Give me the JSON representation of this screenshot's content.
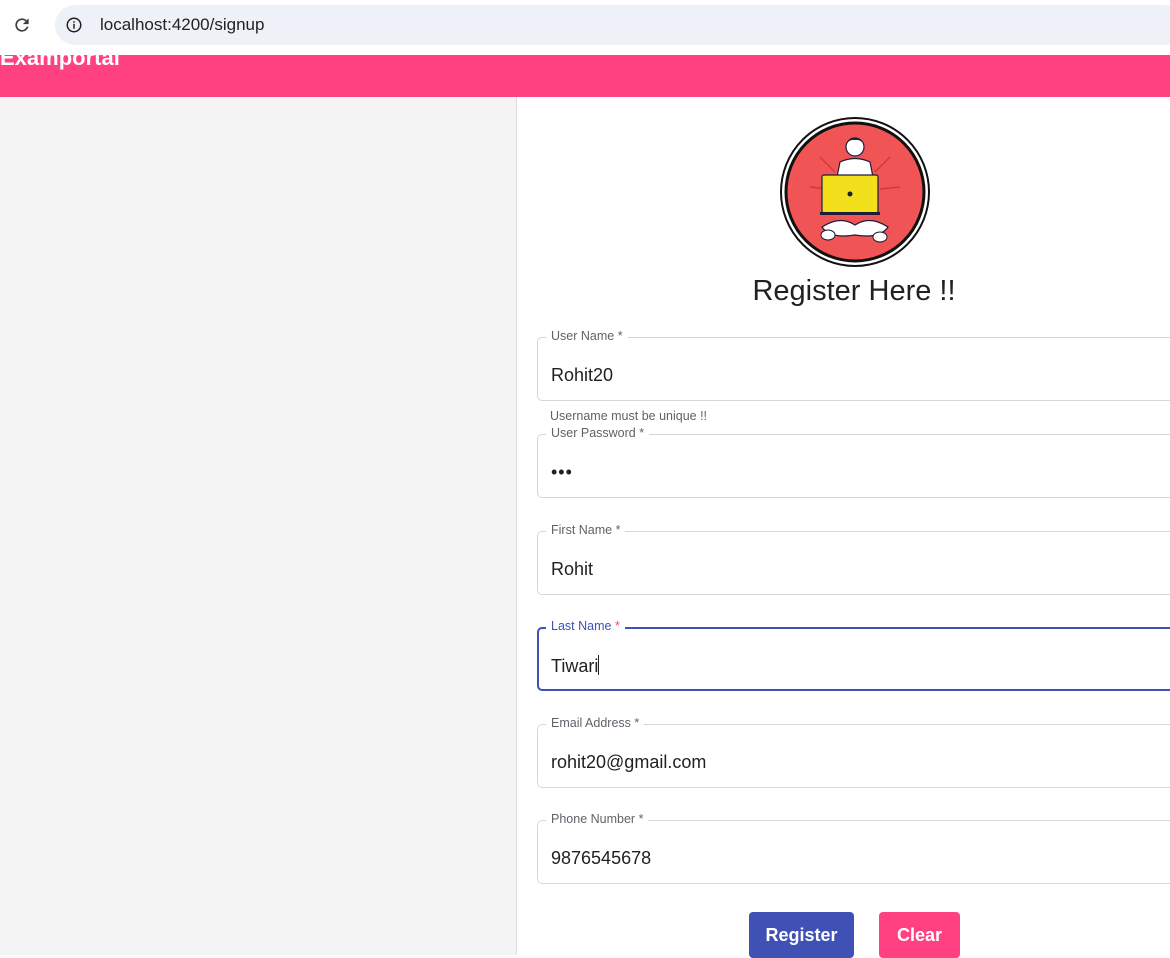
{
  "browser": {
    "url": "localhost:4200/signup",
    "reload_icon": "reload-icon",
    "info_icon": "info-icon"
  },
  "app": {
    "title": "Examportal",
    "header_color": "#ff4081"
  },
  "form": {
    "heading": "Register Here !!",
    "logo": "user-with-laptop-avatar",
    "fields": [
      {
        "label": "User Name",
        "value": "Rohit20",
        "required": "*"
      },
      {
        "label": "User Password",
        "value": "•••",
        "required": "*"
      },
      {
        "label": "First Name",
        "value": "Rohit",
        "required": "*"
      },
      {
        "label": "Last Name",
        "value": "Tiwari",
        "required": "*"
      },
      {
        "label": "Email Address",
        "value": "rohit20@gmail.com",
        "required": "*"
      },
      {
        "label": "Phone Number",
        "value": "9876545678",
        "required": "*"
      }
    ],
    "username_hint": "Username must be unique !!",
    "focused_field": "Last Name",
    "accent_color": "#3f51b5",
    "register_label": "Register",
    "clear_label": "Clear"
  }
}
